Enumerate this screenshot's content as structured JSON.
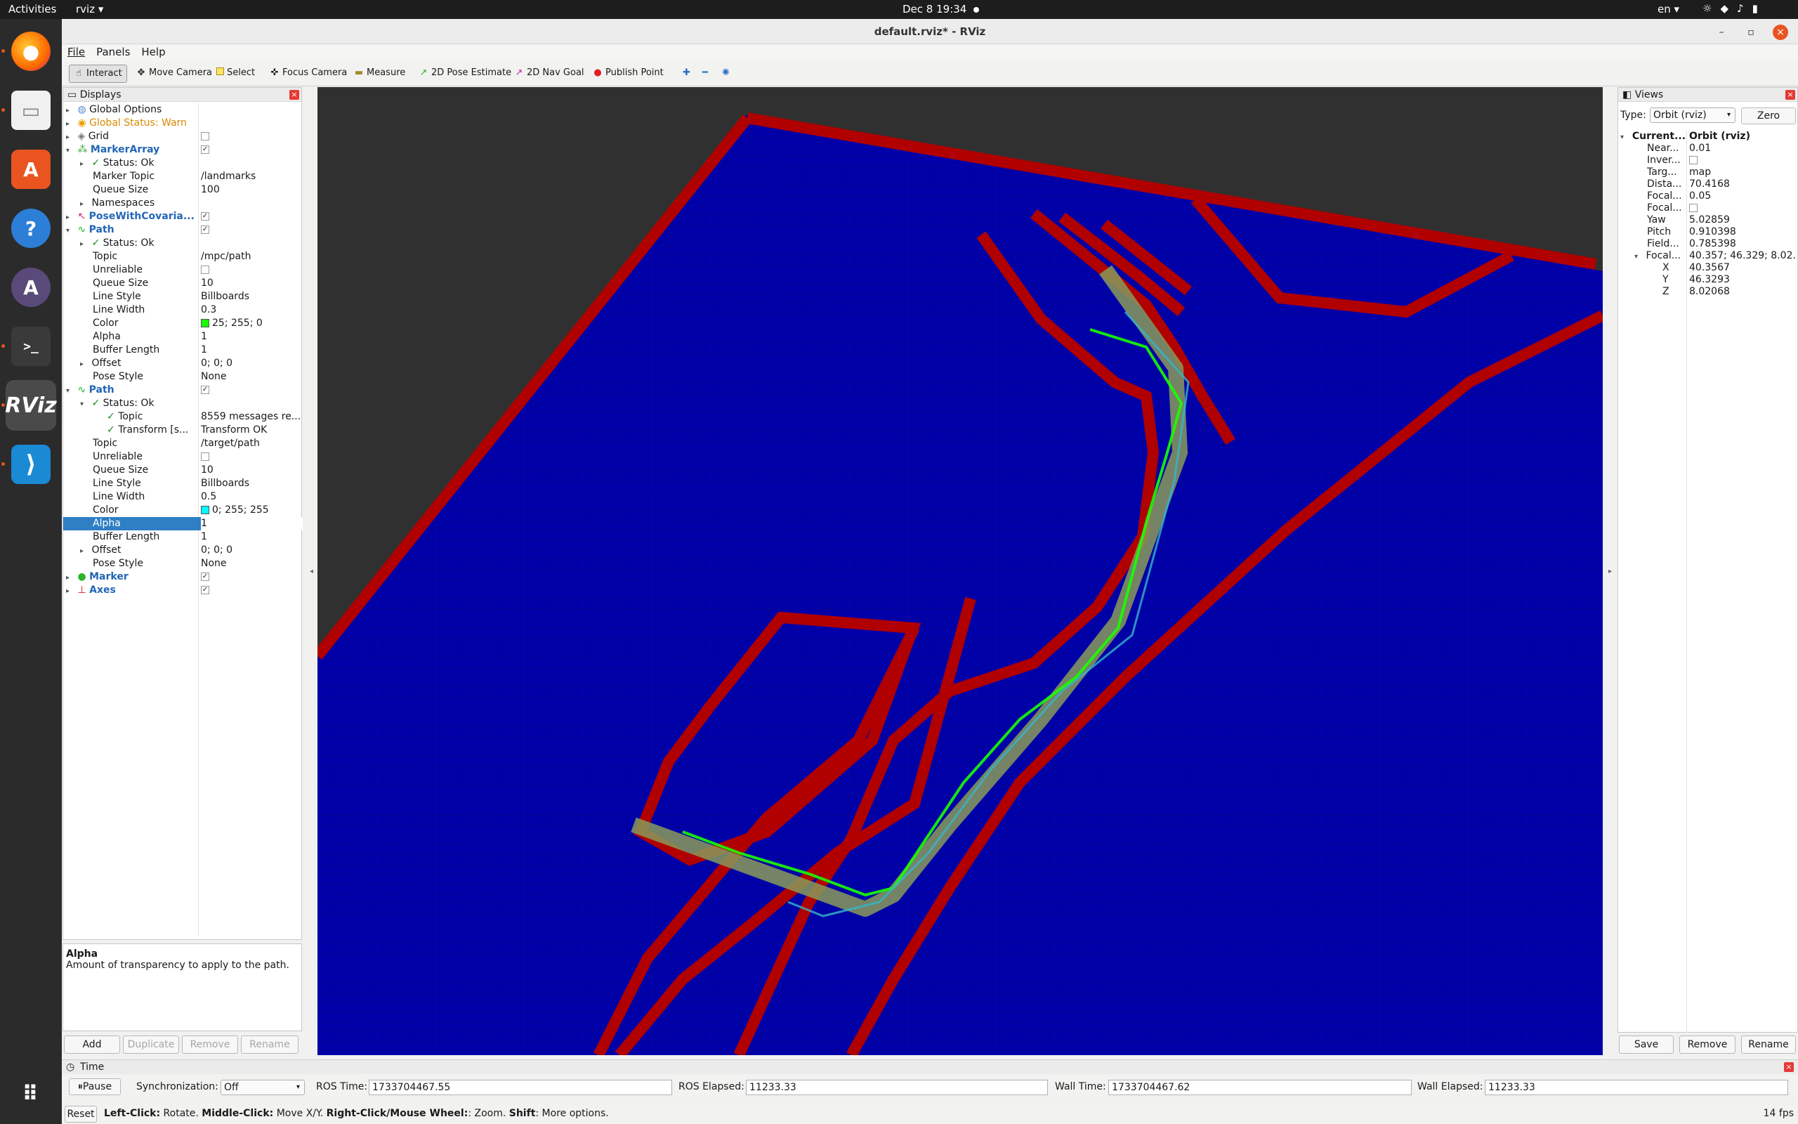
{
  "topbar": {
    "activities": "Activities",
    "app_name": "rviz",
    "clock": "Dec 8  19:34",
    "lang": "en"
  },
  "dock": {
    "items": [
      "Firefox",
      "Files",
      "App Center",
      "Help",
      "Arduino",
      "Terminal",
      "RViz",
      "VS Code"
    ]
  },
  "window": {
    "title": "default.rviz* - RViz"
  },
  "menu": {
    "file": "File",
    "panels": "Panels",
    "help": "Help"
  },
  "toolbar": {
    "interact": "Interact",
    "move_camera": "Move Camera",
    "select": "Select",
    "focus_camera": "Focus Camera",
    "measure": "Measure",
    "pose_estimate": "2D Pose Estimate",
    "nav_goal": "2D Nav Goal",
    "publish_point": "Publish Point"
  },
  "displays": {
    "title": "Displays",
    "rows": [
      {
        "name": "Global Options",
        "value": ""
      },
      {
        "name": "Global Status: Warn",
        "value": ""
      },
      {
        "name": "Grid",
        "value": ""
      },
      {
        "name": "MarkerArray",
        "value": ""
      },
      {
        "name": "Status: Ok",
        "value": ""
      },
      {
        "name": "Marker Topic",
        "value": "/landmarks"
      },
      {
        "name": "Queue Size",
        "value": "100"
      },
      {
        "name": "Namespaces",
        "value": ""
      },
      {
        "name": "PoseWithCovaria...",
        "value": ""
      },
      {
        "name": "Path",
        "value": ""
      },
      {
        "name": "Status: Ok",
        "value": ""
      },
      {
        "name": "Topic",
        "value": "/mpc/path"
      },
      {
        "name": "Unreliable",
        "value": ""
      },
      {
        "name": "Queue Size",
        "value": "10"
      },
      {
        "name": "Line Style",
        "value": "Billboards"
      },
      {
        "name": "Line Width",
        "value": "0.3"
      },
      {
        "name": "Color",
        "value": "25; 255; 0"
      },
      {
        "name": "Alpha",
        "value": "1"
      },
      {
        "name": "Buffer Length",
        "value": "1"
      },
      {
        "name": "Offset",
        "value": "0; 0; 0"
      },
      {
        "name": "Pose Style",
        "value": "None"
      },
      {
        "name": "Path",
        "value": ""
      },
      {
        "name": "Status: Ok",
        "value": ""
      },
      {
        "name": "Topic",
        "value": "8559 messages re..."
      },
      {
        "name": "Transform [s...",
        "value": "Transform OK"
      },
      {
        "name": "Topic",
        "value": "/target/path"
      },
      {
        "name": "Unreliable",
        "value": ""
      },
      {
        "name": "Queue Size",
        "value": "10"
      },
      {
        "name": "Line Style",
        "value": "Billboards"
      },
      {
        "name": "Line Width",
        "value": "0.5"
      },
      {
        "name": "Color",
        "value": "0; 255; 255"
      },
      {
        "name": "Alpha",
        "value": "1"
      },
      {
        "name": "Buffer Length",
        "value": "1"
      },
      {
        "name": "Offset",
        "value": "0; 0; 0"
      },
      {
        "name": "Pose Style",
        "value": "None"
      },
      {
        "name": "Marker",
        "value": ""
      },
      {
        "name": "Axes",
        "value": ""
      }
    ],
    "help_title": "Alpha",
    "help_text": "Amount of transparency to apply to the path.",
    "buttons": {
      "add": "Add",
      "duplicate": "Duplicate",
      "remove": "Remove",
      "rename": "Rename"
    }
  },
  "colors": {
    "mpc_path": "#19ff00",
    "target_path": "#00ffff",
    "occupied": "#b00000",
    "free": "#0000a8",
    "unknown": "#303030",
    "selection": "#2f7fc4"
  },
  "views": {
    "title": "Views",
    "type_label": "Type:",
    "type_value": "Orbit (rviz)",
    "zero": "Zero",
    "rows": [
      {
        "name": "Current...",
        "value": "Orbit (rviz)"
      },
      {
        "name": "Near...",
        "value": "0.01"
      },
      {
        "name": "Inver...",
        "value": ""
      },
      {
        "name": "Targ...",
        "value": "map"
      },
      {
        "name": "Dista...",
        "value": "70.4168"
      },
      {
        "name": "Focal...",
        "value": "0.05"
      },
      {
        "name": "Focal...",
        "value": ""
      },
      {
        "name": "Yaw",
        "value": "5.02859"
      },
      {
        "name": "Pitch",
        "value": "0.910398"
      },
      {
        "name": "Field...",
        "value": "0.785398"
      },
      {
        "name": "Focal...",
        "value": "40.357; 46.329; 8.02..."
      },
      {
        "name": "X",
        "value": "40.3567"
      },
      {
        "name": "Y",
        "value": "46.3293"
      },
      {
        "name": "Z",
        "value": "8.02068"
      }
    ],
    "buttons": {
      "save": "Save",
      "remove": "Remove",
      "rename": "Rename"
    }
  },
  "time": {
    "title": "Time",
    "pause": "Pause",
    "sync_label": "Synchronization:",
    "sync_value": "Off",
    "ros_time_label": "ROS Time:",
    "ros_time": "1733704467.55",
    "ros_elapsed_label": "ROS Elapsed:",
    "ros_elapsed": "11233.33",
    "wall_time_label": "Wall Time:",
    "wall_time": "1733704467.62",
    "wall_elapsed_label": "Wall Elapsed:",
    "wall_elapsed": "11233.33"
  },
  "status": {
    "reset": "Reset",
    "lc": "Left-Click:",
    "lc_t": " Rotate. ",
    "mc": "Middle-Click:",
    "mc_t": " Move X/Y. ",
    "rc": "Right-Click/Mouse Wheel:",
    "rc_t": ": Zoom. ",
    "sh": "Shift",
    "sh_t": ": More options.",
    "fps": "14 fps"
  }
}
